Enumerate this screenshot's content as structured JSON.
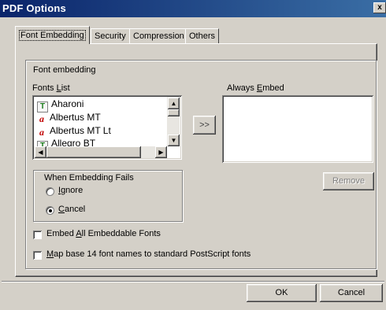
{
  "window": {
    "title": "PDF Options",
    "close_glyph": "x"
  },
  "tabs": [
    {
      "label": "Font Embedding",
      "active": true
    },
    {
      "label": "Security",
      "active": false
    },
    {
      "label": "Compression",
      "active": false
    },
    {
      "label": "Others",
      "active": false
    }
  ],
  "font_embedding": {
    "group_label": "Font embedding",
    "fonts_list": {
      "label_pre": "Fonts ",
      "label_accel": "L",
      "label_post": "ist",
      "items": [
        {
          "name": "Aharoni",
          "icon": "truetype-icon"
        },
        {
          "name": "Albertus MT",
          "icon": "postscript-icon"
        },
        {
          "name": "Albertus MT Lt",
          "icon": "postscript-icon"
        },
        {
          "name": "Allegro BT",
          "icon": "truetype-icon"
        }
      ]
    },
    "add_button_label": ">>",
    "always_embed": {
      "label_pre": "Always ",
      "label_accel": "E",
      "label_post": "mbed",
      "items": []
    },
    "remove_button_label": "Remove",
    "when_fails": {
      "group_label": "When Embedding Fails",
      "options": [
        {
          "accel": "I",
          "rest": "gnore",
          "selected": false
        },
        {
          "accel": "C",
          "rest": "ancel",
          "selected": true
        }
      ]
    },
    "embed_all": {
      "pre": "Embed ",
      "accel": "A",
      "post": "ll Embeddable Fonts",
      "checked": false
    },
    "map_base14": {
      "pre": "",
      "accel": "M",
      "post": "ap base 14 font names to standard PostScript fonts",
      "checked": false
    }
  },
  "footer": {
    "ok_label": "OK",
    "cancel_label": "Cancel"
  },
  "colors": {
    "titlebar_start": "#0a246a",
    "titlebar_end": "#3a6ea5",
    "dialog_bg": "#d4d0c8"
  }
}
